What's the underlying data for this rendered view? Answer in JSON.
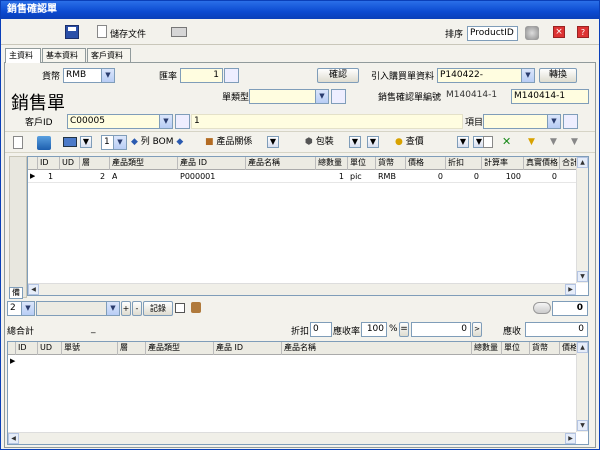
{
  "window": {
    "title": "銷售確認單"
  },
  "toolbar": {
    "save_doc_label": "儲存文件",
    "sort_label": "排序",
    "sort_value": "ProductID"
  },
  "tabs": [
    {
      "label": "主資料"
    },
    {
      "label": "基本資料"
    },
    {
      "label": "客戶資料"
    }
  ],
  "header": {
    "currency_label": "貨幣",
    "currency_value": "RMB",
    "rate_label": "匯率",
    "rate_value": "1",
    "confirm_button": "確認",
    "import_label": "引入購買單資料",
    "import_value": "P140422-",
    "convert_button": "轉換",
    "big_title": "銷售單",
    "doc_type_label": "單類型",
    "doc_type_value": "",
    "confirm_no_label": "銷售確認單編號",
    "confirm_no_value1": "M140414-1",
    "confirm_no_value2": "M140414-1",
    "customer_id_label": "客戶ID",
    "customer_id_value": "C00005",
    "customer_count": "1",
    "item_label": "項目",
    "item_value": ""
  },
  "subtoolbar": {
    "spin_value": "1",
    "bom_label": "列 BOM",
    "product_rel_label": "產品關係",
    "pack_label": "包裝",
    "price_label": "查價"
  },
  "main_grid": {
    "columns": [
      "ID",
      "UD",
      "層",
      "產品類型",
      "產品 ID",
      "產品名稱",
      "總數量",
      "單位",
      "貨幣",
      "價格",
      "折扣",
      "計算率",
      "真實價格",
      "合計"
    ],
    "rows": [
      {
        "id": "1",
        "ud": "",
        "layer": "2",
        "type": "A",
        "pid": "P000001",
        "pname": "",
        "qty": "1",
        "unit": "pic",
        "currency": "RMB",
        "price": "0",
        "discount": "0",
        "rate": "100",
        "real_price": "0",
        "total": ""
      }
    ]
  },
  "nav": {
    "spin_value": "2",
    "record_label": "記錄",
    "left_side_label": "備",
    "right_value": "0"
  },
  "totals": {
    "total_label": "總合計",
    "total_value": "_",
    "discount_label": "折扣",
    "discount_value": "0",
    "receivable_rate_label": "應收率",
    "receivable_rate_value": "100",
    "percent": "%",
    "eq": "=",
    "mid_value": "0",
    "receivable_label": "應收",
    "receivable_value": "0"
  },
  "lower_grid": {
    "columns": [
      "ID",
      "UD",
      "單號",
      "層",
      "產品類型",
      "產品 ID",
      "產品名稱",
      "總數量",
      "單位",
      "貨幣",
      "價格"
    ]
  }
}
